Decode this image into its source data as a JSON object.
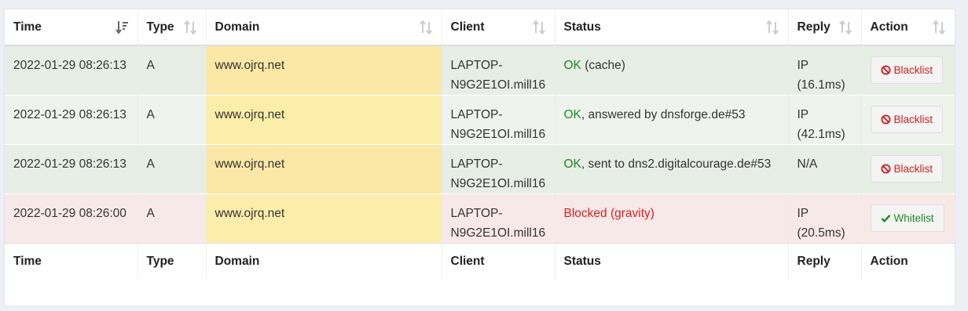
{
  "headers": [
    "Time",
    "Type",
    "Domain",
    "Client",
    "Status",
    "Reply",
    "Action"
  ],
  "rows": [
    {
      "time": "2022-01-29 08:26:13",
      "type": "A",
      "domain": "www.ojrq.net",
      "client_a": "LAPTOP-",
      "client_b": "N9G2E1OI.mill16",
      "status_ok": "OK",
      "status_rest": " (cache)",
      "reply_a": "IP",
      "reply_b": "(16.1ms)",
      "action": "Blacklist",
      "kind": "ok1"
    },
    {
      "time": "2022-01-29 08:26:13",
      "type": "A",
      "domain": "www.ojrq.net",
      "client_a": "LAPTOP-",
      "client_b": "N9G2E1OI.mill16",
      "status_ok": "OK",
      "status_rest": ", answered by dnsforge.de#53",
      "reply_a": "IP",
      "reply_b": "(42.1ms)",
      "action": "Blacklist",
      "kind": "ok2"
    },
    {
      "time": "2022-01-29 08:26:13",
      "type": "A",
      "domain": "www.ojrq.net",
      "client_a": "LAPTOP-",
      "client_b": "N9G2E1OI.mill16",
      "status_ok": "OK",
      "status_rest": ", sent to dns2.digitalcourage.de#53",
      "reply_a": "N/A",
      "reply_b": "",
      "action": "Blacklist",
      "kind": "ok1"
    },
    {
      "time": "2022-01-29 08:26:00",
      "type": "A",
      "domain": "www.ojrq.net",
      "client_a": "LAPTOP-",
      "client_b": "N9G2E1OI.mill16",
      "status_blocked": "Blocked (gravity)",
      "reply_a": "IP",
      "reply_b": "(20.5ms)",
      "action": "Whitelist",
      "kind": "blk"
    }
  ],
  "colors": {
    "ok": "#1e8a1e",
    "blocked": "#dd1e1e",
    "domain_highlight": "#fdedaa"
  },
  "icons": {
    "sort_active": "sort-desc-icon",
    "sort": "sort-icon",
    "blacklist": "ban-icon",
    "whitelist": "check-icon"
  }
}
